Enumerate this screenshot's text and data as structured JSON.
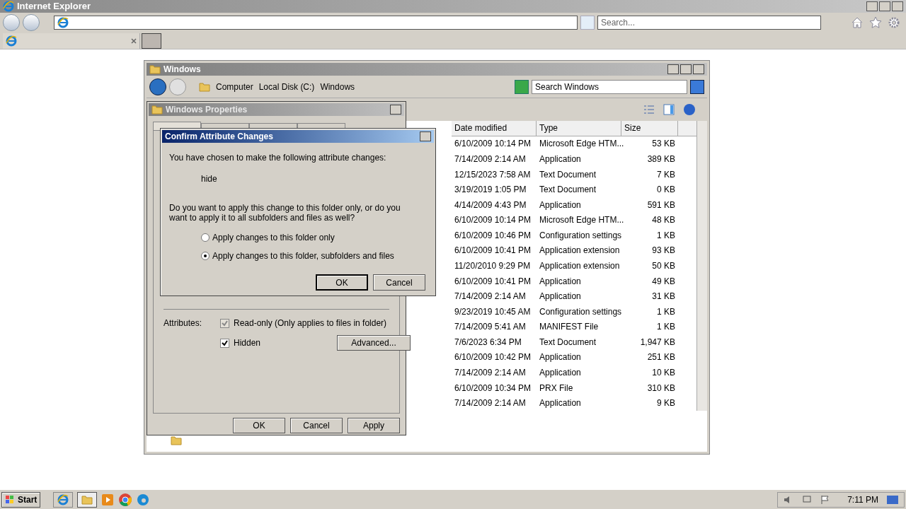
{
  "browser": {
    "title": "Internet Explorer",
    "search_placeholder": "Search..."
  },
  "explorer": {
    "title": "Windows",
    "breadcrumb": [
      "Computer",
      "Local Disk (C:)",
      "Windows"
    ],
    "search_placeholder": "Search Windows",
    "columns": [
      "Date modified",
      "Type",
      "Size"
    ],
    "rows": [
      {
        "date": "6/10/2009 10:14 PM",
        "type": "Microsoft Edge HTM...",
        "size": "53 KB"
      },
      {
        "date": "7/14/2009 2:14 AM",
        "type": "Application",
        "size": "389 KB"
      },
      {
        "date": "12/15/2023 7:58 AM",
        "type": "Text Document",
        "size": "7 KB"
      },
      {
        "date": "3/19/2019 1:05 PM",
        "type": "Text Document",
        "size": "0 KB"
      },
      {
        "date": "4/14/2009 4:43 PM",
        "type": "Application",
        "size": "591 KB"
      },
      {
        "date": "6/10/2009 10:14 PM",
        "type": "Microsoft Edge HTM...",
        "size": "48 KB"
      },
      {
        "date": "6/10/2009 10:46 PM",
        "type": "Configuration settings",
        "size": "1 KB"
      },
      {
        "date": "6/10/2009 10:41 PM",
        "type": "Application extension",
        "size": "93 KB"
      },
      {
        "date": "11/20/2010 9:29 PM",
        "type": "Application extension",
        "size": "50 KB"
      },
      {
        "date": "6/10/2009 10:41 PM",
        "type": "Application",
        "size": "49 KB"
      },
      {
        "date": "7/14/2009 2:14 AM",
        "type": "Application",
        "size": "31 KB"
      },
      {
        "date": "9/23/2019 10:45 AM",
        "type": "Configuration settings",
        "size": "1 KB"
      },
      {
        "date": "7/14/2009 5:41 AM",
        "type": "MANIFEST File",
        "size": "1 KB"
      },
      {
        "date": "7/6/2023 6:34 PM",
        "type": "Text Document",
        "size": "1,947 KB"
      },
      {
        "date": "6/10/2009 10:42 PM",
        "type": "Application",
        "size": "251 KB"
      },
      {
        "date": "7/14/2009 2:14 AM",
        "type": "Application",
        "size": "10 KB"
      },
      {
        "date": "6/10/2009 10:34 PM",
        "type": "PRX File",
        "size": "310 KB"
      },
      {
        "date": "7/14/2009 2:14 AM",
        "type": "Application",
        "size": "9 KB"
      }
    ]
  },
  "properties": {
    "title": "Windows Properties",
    "tabs": [
      {
        "selected": true
      },
      {
        "selected": false
      },
      {
        "selected": false
      },
      {
        "selected": false
      }
    ],
    "attributes_label": "Attributes:",
    "attributes": [
      {
        "label": "Read-only (Only applies to files in folder)",
        "checked": true,
        "grayed": true
      },
      {
        "label": "Hidden",
        "checked": true,
        "grayed": false
      }
    ],
    "advanced_button": "Advanced...",
    "buttons": [
      "OK",
      "Cancel",
      "Apply"
    ]
  },
  "confirm": {
    "title": "Confirm Attribute Changes",
    "intro": "You have chosen to make the following attribute changes:",
    "change": "hide",
    "question": "Do you want to apply this change to this folder only, or do you want to apply it to all subfolders and files as well?",
    "options": [
      {
        "label": "Apply changes to this folder only",
        "selected": false
      },
      {
        "label": "Apply changes to this folder, subfolders and files",
        "selected": true
      }
    ],
    "buttons": [
      "OK",
      "Cancel"
    ]
  },
  "taskbar": {
    "start": "Start",
    "time": "7:11 PM"
  }
}
